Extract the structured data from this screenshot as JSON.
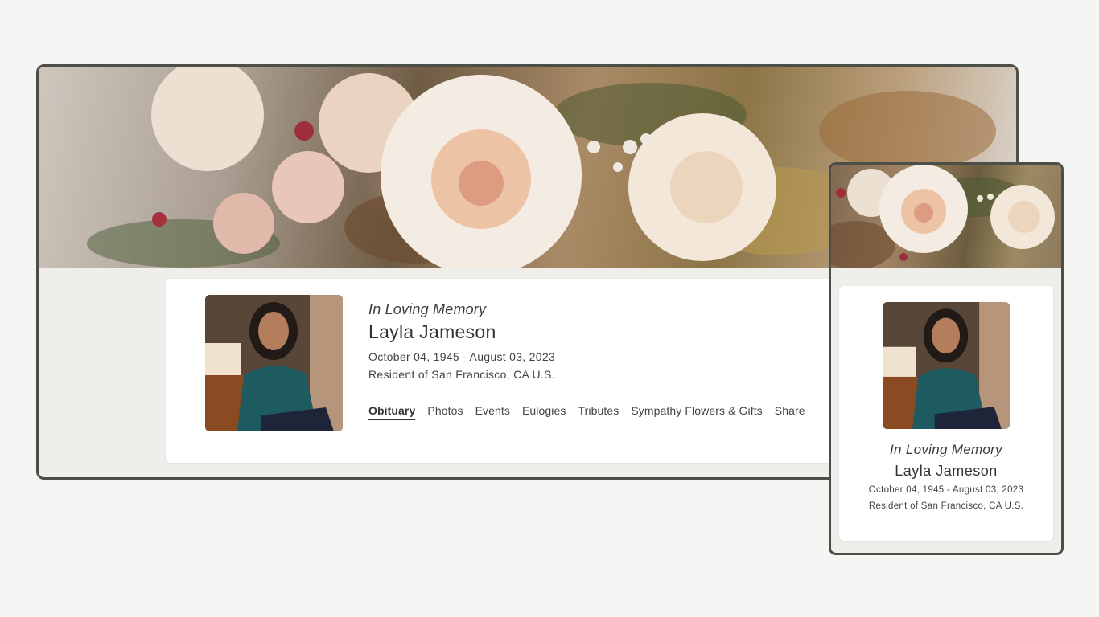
{
  "desktop": {
    "banner_image": "flower-bouquet-banner",
    "profile": {
      "heading": "In Loving Memory",
      "name": "Layla Jameson",
      "dates": "October 04, 1945 - August 03, 2023",
      "residence": "Resident of San Francisco, CA U.S."
    },
    "tabs": [
      {
        "label": "Obituary",
        "active": true
      },
      {
        "label": "Photos",
        "active": false
      },
      {
        "label": "Events",
        "active": false
      },
      {
        "label": "Eulogies",
        "active": false
      },
      {
        "label": "Tributes",
        "active": false
      },
      {
        "label": "Sympathy Flowers & Gifts",
        "active": false
      },
      {
        "label": "Share",
        "active": false
      }
    ]
  },
  "mobile": {
    "banner_image": "flower-bouquet-banner",
    "profile": {
      "heading": "In Loving Memory",
      "name": "Layla Jameson",
      "dates": "October 04, 1945 - August 03, 2023",
      "residence": "Resident of San Francisco, CA U.S."
    }
  },
  "colors": {
    "frame_border": "#4c4e48",
    "page_background": "#f5f5f4",
    "content_background": "#efeeea",
    "card_background": "#ffffff",
    "text": "#3b3b3b"
  }
}
